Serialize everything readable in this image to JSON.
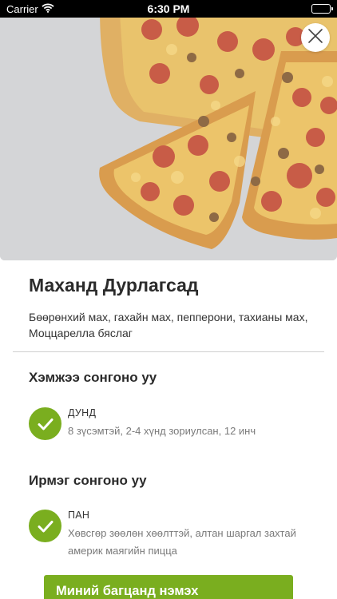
{
  "status_bar": {
    "carrier": "Carrier",
    "time": "6:30 PM",
    "icons": [
      "wifi-icon",
      "battery-icon"
    ]
  },
  "hero": {
    "image": "pizza-photo",
    "close_icon": "close-icon"
  },
  "product": {
    "title": "Маханд Дурлагсад",
    "description": "Бөөрөнхий мах, гахайн мах, пепперони, тахианы мах, Моццарелла бяслаг"
  },
  "size_section": {
    "title": "Хэмжээ сонгоно уу",
    "option": {
      "name": "ДУНД",
      "description": "8 зүсэмтэй, 2-4 хүнд зориулсан, 12 инч",
      "selected": true
    }
  },
  "crust_section": {
    "title": "Ирмэг сонгоно уу",
    "option": {
      "name": "ПАН",
      "description": "Хөвсгөр зөөлөн хөөлттэй, алтан шаргал захтай америк маягийн пицца",
      "selected": true
    }
  },
  "add_to_cart": {
    "label": "Миний багцанд нэмэх"
  },
  "colors": {
    "accent": "#7aae1f",
    "text": "#2b2b2b",
    "muted": "#7a7a7a",
    "divider": "#cfcfcf"
  }
}
